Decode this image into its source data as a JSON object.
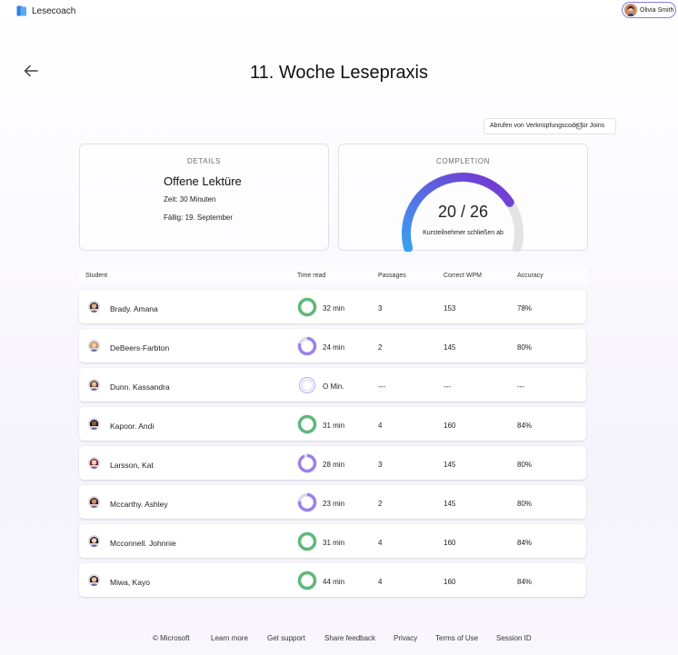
{
  "app": {
    "name": "Lesecoach",
    "icon": "book-icon"
  },
  "user": {
    "name": "Olivia Smith"
  },
  "page": {
    "title": "11. Woche Lesepraxis",
    "back_icon": "arrow-left-icon"
  },
  "join_code_button": {
    "label": "Abrufen von Verknüpfungscode für Joins",
    "icon": "gear-icon"
  },
  "details": {
    "heading": "DETAILS",
    "title": "Offene Lektüre",
    "time": "Zeit: 30 Minuten",
    "due": "Fällig: 19. September"
  },
  "completion": {
    "heading": "COMPLETION",
    "count": "20 / 26",
    "completed": 20,
    "total": 26,
    "subtitle": "Kursteilnehmer schließen ab",
    "colors": {
      "start": "#3aa0f0",
      "end": "#7a2fd0",
      "track": "#e3e3e3"
    }
  },
  "table": {
    "columns": [
      "Student",
      "Time read",
      "Passages",
      "Correct WPM",
      "Accuracy"
    ],
    "rows": [
      {
        "name": "Brady. Amana",
        "time": "32 min",
        "progress": 1.0,
        "passages": "3",
        "wpm": "153",
        "accuracy": "78%"
      },
      {
        "name": "DeBeers-Farbton",
        "time": "24 min",
        "progress": 0.8,
        "passages": "2",
        "wpm": "145",
        "accuracy": "80%"
      },
      {
        "name": "Dunn. Kassandra",
        "time": "O Min.",
        "progress": 0.0,
        "passages": "---",
        "wpm": "---",
        "accuracy": "---"
      },
      {
        "name": "Kapoor. Andi",
        "time": "31 min",
        "progress": 1.0,
        "passages": "4",
        "wpm": "160",
        "accuracy": "84%"
      },
      {
        "name": "Larsson, Kat",
        "time": "28 min",
        "progress": 0.93,
        "passages": "3",
        "wpm": "145",
        "accuracy": "80%"
      },
      {
        "name": "Mccarthy. Ashley",
        "time": "23 min",
        "progress": 0.77,
        "passages": "2",
        "wpm": "145",
        "accuracy": "80%"
      },
      {
        "name": "Mcconnell. Johnnie",
        "time": "31 min",
        "progress": 1.0,
        "passages": "4",
        "wpm": "160",
        "accuracy": "84%"
      },
      {
        "name": "Miwa, Kayo",
        "time": "44 min",
        "progress": 1.0,
        "passages": "4",
        "wpm": "160",
        "accuracy": "84%"
      }
    ],
    "ring_colors": {
      "complete": "#5fb87a",
      "partial": "#9b82e6",
      "track": "#ddd6f5"
    }
  },
  "footer": {
    "links": [
      "© Microsoft",
      "Learn more",
      "Get support",
      "Share feedback",
      "Privacy",
      "Terms of Use",
      "Session ID"
    ]
  }
}
